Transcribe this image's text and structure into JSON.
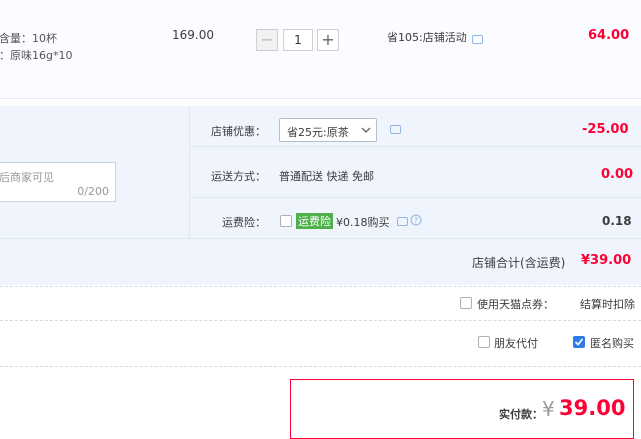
{
  "item": {
    "attr1": "含量：10杯",
    "attr2": "：原味16g*10",
    "unit_price": "169.00",
    "quantity": "1",
    "minus": "−",
    "plus": "+",
    "promo": "省105:店铺活动",
    "subtotal": "64.00"
  },
  "note": {
    "placeholder_visible": "后商家可见",
    "counter": "0/200"
  },
  "shop_discount": {
    "label": "店铺优惠：",
    "selected": "省25元:原茶",
    "amount": "-25.00"
  },
  "shipping": {
    "label": "运送方式：",
    "value": "普通配送 快递 免邮",
    "amount": "0.00"
  },
  "insurance": {
    "label": "运费险：",
    "badge": "运费险",
    "text": "¥0.18购买",
    "amount": "0.18"
  },
  "shop_total": {
    "label": "店铺合计(含运费)",
    "amount": "¥39.00"
  },
  "tmall_points": {
    "label": "使用天猫点券：",
    "note": "结算时扣除"
  },
  "options": {
    "friend_pay": "朋友代付",
    "anonymous": "匿名购买"
  },
  "pay": {
    "label": "实付款：",
    "currency": "¥",
    "amount": "39.00"
  },
  "colors": {
    "accent_red": "#ff0036",
    "badge_green": "#4db04a",
    "check_blue": "#2f7ce6"
  }
}
